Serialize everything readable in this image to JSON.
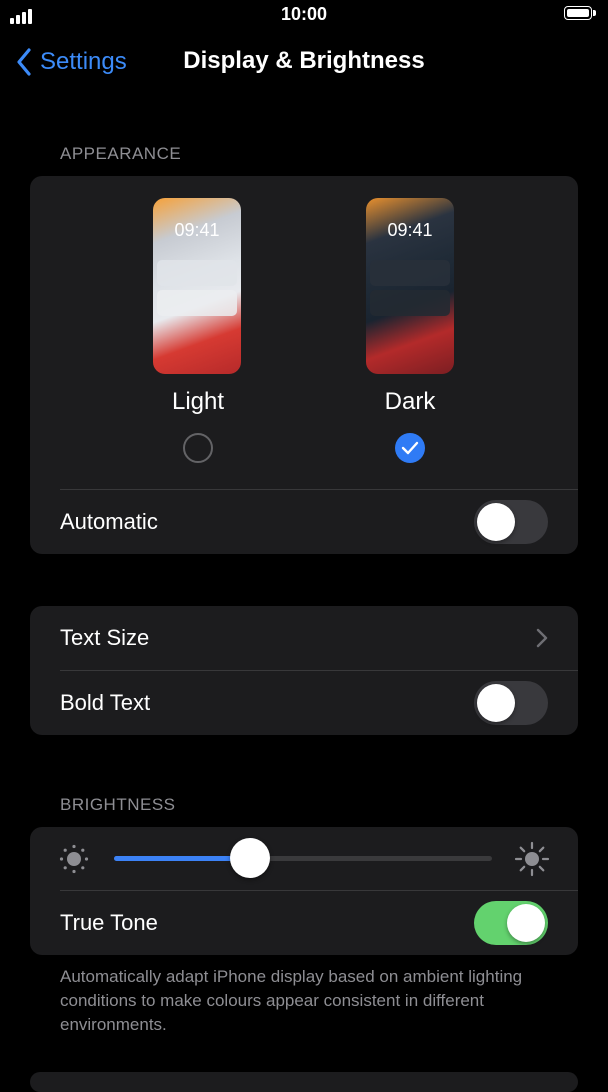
{
  "status_bar": {
    "time": "10:00"
  },
  "nav": {
    "back_label": "Settings",
    "title": "Display & Brightness"
  },
  "appearance": {
    "header": "APPEARANCE",
    "options": [
      {
        "label": "Light",
        "preview_time": "09:41",
        "selected": false
      },
      {
        "label": "Dark",
        "preview_time": "09:41",
        "selected": true
      }
    ],
    "automatic": {
      "label": "Automatic",
      "on": false
    }
  },
  "text": {
    "text_size_label": "Text Size",
    "bold_text": {
      "label": "Bold Text",
      "on": false
    }
  },
  "brightness": {
    "header": "BRIGHTNESS",
    "level": 0.36,
    "true_tone": {
      "label": "True Tone",
      "on": true
    },
    "footnote": "Automatically adapt iPhone display based on ambient lighting conditions to make colours appear consistent in different environments."
  },
  "colors": {
    "accent": "#3c8bf8",
    "toggle_on": "#63d26e",
    "group_bg": "#1c1c1e"
  }
}
